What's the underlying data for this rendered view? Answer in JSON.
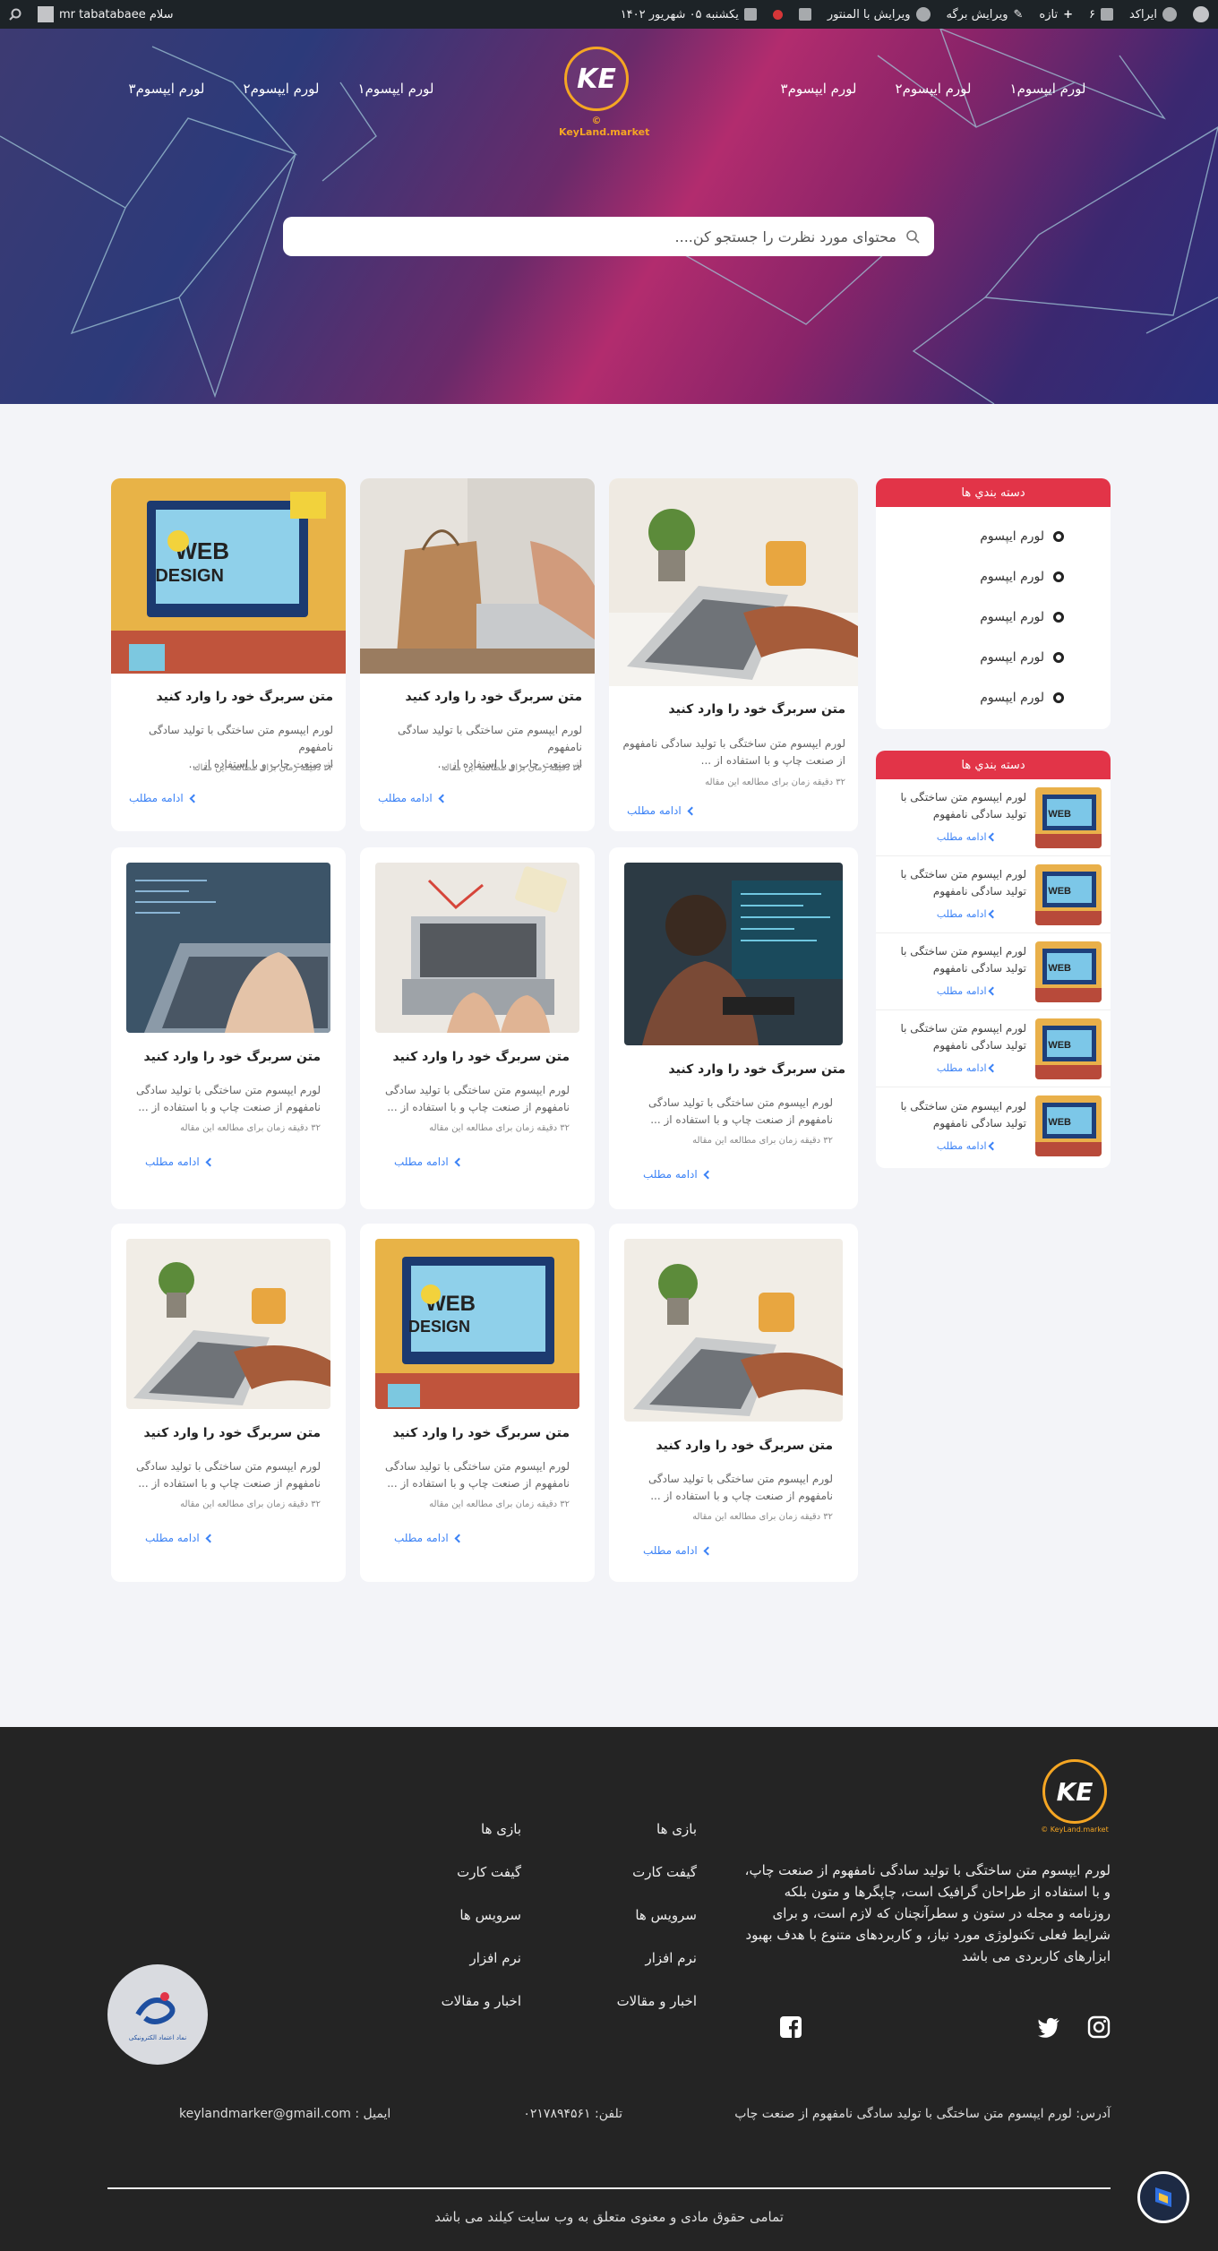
{
  "adminbar": {
    "site_name": "ایراکد",
    "comments_count": "۶",
    "new_label": "تازه",
    "edit_page_label": "ویرایش برگه",
    "edit_elementor_label": "ویرایش با المنتور",
    "date_label": "یکشنبه ۰۵ شهریور ۱۴۰۲",
    "greeting": "سلام mr tabatabaee"
  },
  "header": {
    "nav_right": [
      "لورم ایپسوم۱",
      "لورم ایپسوم۲",
      "لورم ایپسوم۳"
    ],
    "nav_left": [
      "لورم ایپسوم۱",
      "لورم ایپسوم۲",
      "لورم ایپسوم۳"
    ],
    "logo_text": "© KeyLand.market",
    "search_placeholder": "محتوای مورد نظرت را جستجو کن...."
  },
  "sidebar": {
    "categories_title": "دسته بندي ها",
    "categories": [
      "لورم ایپسوم",
      "لورم ایپسوم",
      "لورم ایپسوم",
      "لورم ایپسوم",
      "لورم ایپسوم"
    ],
    "recent_title": "دسته بندي ها",
    "recent": [
      {
        "line1": "لورم ایپسوم متن ساختگی با",
        "line2": "تولید سادگی نامفهوم",
        "more": "ادامه مطلب"
      },
      {
        "line1": "لورم ایپسوم متن ساختگی با",
        "line2": "تولید سادگی نامفهوم",
        "more": "ادامه مطلب"
      },
      {
        "line1": "لورم ایپسوم متن ساختگی با",
        "line2": "تولید سادگی نامفهوم",
        "more": "ادامه مطلب"
      },
      {
        "line1": "لورم ایپسوم متن ساختگی با",
        "line2": "تولید سادگی نامفهوم",
        "more": "ادامه مطلب"
      },
      {
        "line1": "لورم ایپسوم متن ساختگی با",
        "line2": "تولید سادگی نامفهوم",
        "more": "ادامه مطلب"
      }
    ]
  },
  "posts": {
    "title": "متن سربرگ خود را وارد کنید",
    "excerpt_line1": "لورم ایپسوم متن ساختگی با تولید سادگی نامفهوم",
    "excerpt_line2": "از صنعت چاپ و با استفاده از ...",
    "excerpt_narrow_line1": "لورم ایپسوم متن ساختگی با تولید سادگی",
    "excerpt_narrow_line2": "نامفهوم از صنعت چاپ و با استفاده از ...",
    "meta": "۳۲ دقیقه زمان برای مطالعه این مقاله",
    "more": "ادامه مطلب"
  },
  "footer": {
    "logo_text": "© KeyLand.market",
    "about": "لورم ایپسوم متن ساختگی با تولید سادگی نامفهوم از صنعت چاپ، و با استفاده از طراحان گرافیک است، چاپگرها و متون بلکه روزنامه و مجله در ستون و سطرآنچنان که لازم است، و برای شرایط فعلی تکنولوژی مورد نیاز، و کاربردهای متنوع با هدف بهبود ابزارهای کاربردی می باشد",
    "links_col1": [
      "بازی ها",
      "گیفت کارت",
      "سرویس ها",
      "نرم افزار",
      "اخبار و مقالات"
    ],
    "links_col2": [
      "بازی ها",
      "گیفت کارت",
      "سرویس ها",
      "نرم افزار",
      "اخبار و مقالات"
    ],
    "enamad_text": "نماد اعتماد الکترونیکی",
    "address": "آدرس: لورم ایپسوم متن ساختگی با تولید سادگی نامفهوم از صنعت چاپ",
    "phone": "تلفن: ۰۲۱۷۸۹۴۵۶۱",
    "email": "ایمیل : keylandmarker@gmail.com",
    "copyright": "تمامی حقوق مادی و معنوی متعلق به وب سایت کیلند می باشد"
  },
  "colors": {
    "accent": "#e23448",
    "link": "#3b82f6",
    "footer_bg": "#242424",
    "logo_orange": "#f5a623"
  },
  "icons": [
    "wordpress-icon",
    "comment-icon",
    "plus-icon",
    "pencil-icon",
    "elementor-icon",
    "calendar-icon",
    "search-icon",
    "instagram-icon",
    "twitter-icon",
    "facebook-icon",
    "chevron-left-icon"
  ]
}
